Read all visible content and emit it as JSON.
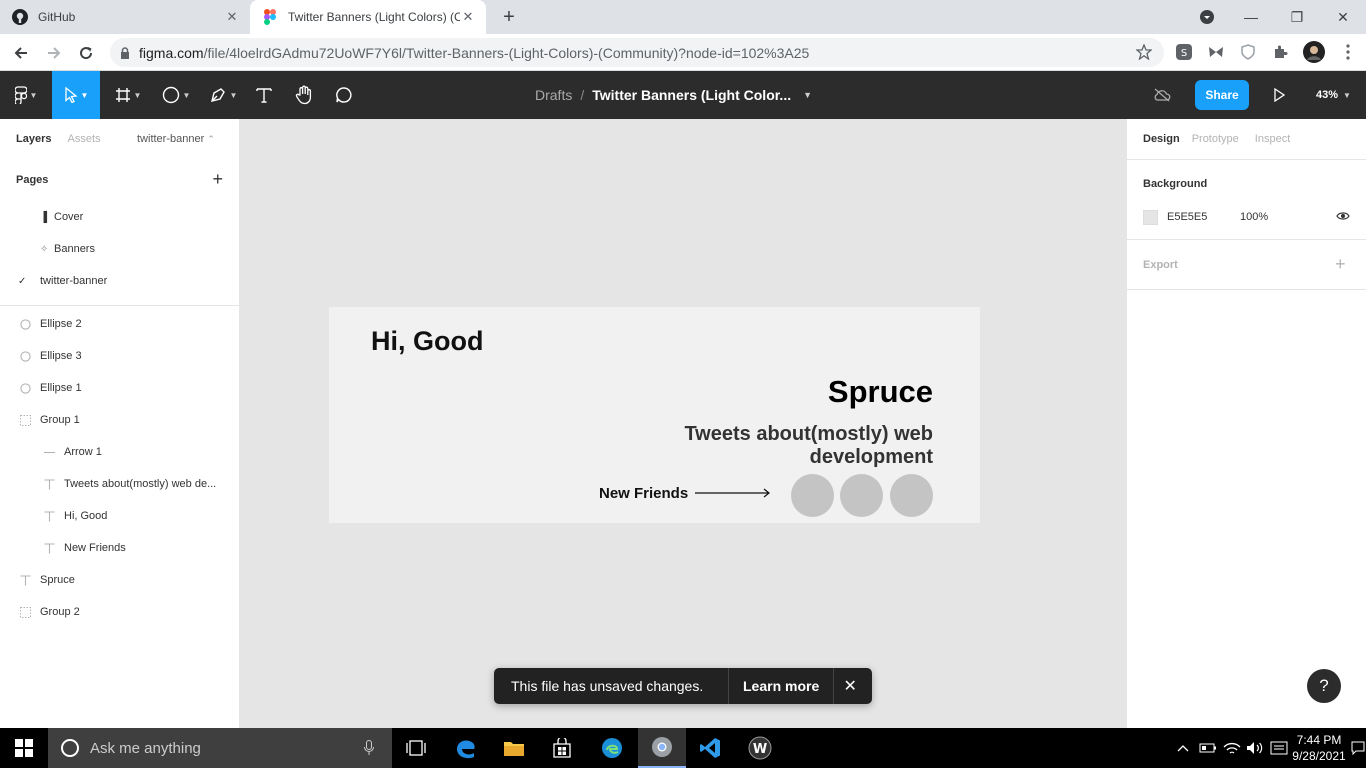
{
  "browser": {
    "tabs": [
      {
        "title": "GitHub",
        "icon": "github-icon"
      },
      {
        "title": "Twitter Banners (Light Colors) (Co",
        "icon": "figma-icon"
      }
    ],
    "url_host": "figma.com",
    "url_path": "/file/4loelrdGAdmu72UoWF7Y6l/Twitter-Banners-(Light-Colors)-(Community)?node-id=102%3A25"
  },
  "figma_toolbar": {
    "breadcrumb_drafts": "Drafts",
    "breadcrumb_sep": "/",
    "file_name": "Twitter Banners (Light Color...",
    "share_label": "Share",
    "zoom": "43%",
    "tools": [
      "main-menu",
      "move",
      "frame",
      "ellipse",
      "pen",
      "text",
      "hand",
      "comment"
    ]
  },
  "left_panel": {
    "tab_layers": "Layers",
    "tab_assets": "Assets",
    "current_page": "twitter-banner",
    "pages_heading": "Pages",
    "pages": [
      {
        "label": "Cover",
        "icon": "▐"
      },
      {
        "label": "Banners",
        "icon": "✧"
      },
      {
        "label": "twitter-banner",
        "icon": "✓"
      }
    ],
    "layers": [
      {
        "label": "Ellipse 2",
        "icon": "ellipse-icon",
        "indent": 0
      },
      {
        "label": "Ellipse 3",
        "icon": "ellipse-icon",
        "indent": 0
      },
      {
        "label": "Ellipse 1",
        "icon": "ellipse-icon",
        "indent": 0
      },
      {
        "label": "Group 1",
        "icon": "group-icon",
        "indent": 0
      },
      {
        "label": "Arrow 1",
        "icon": "line-icon",
        "indent": 1
      },
      {
        "label": "Tweets about(mostly) web de...",
        "icon": "text-icon",
        "indent": 1
      },
      {
        "label": "Hi, Good",
        "icon": "text-icon",
        "indent": 1
      },
      {
        "label": "New Friends",
        "icon": "text-icon",
        "indent": 1
      },
      {
        "label": "Spruce",
        "icon": "text-icon",
        "indent": 0
      },
      {
        "label": "Group 2",
        "icon": "group-icon",
        "indent": 0
      }
    ]
  },
  "banner": {
    "greeting": "Hi, Good",
    "name": "Spruce",
    "tagline": "Tweets about(mostly) web development",
    "cta": "New Friends",
    "circle_color": "#c4c4c4"
  },
  "toast": {
    "message": "This file has unsaved changes.",
    "action": "Learn more"
  },
  "right_panel": {
    "tab_design": "Design",
    "tab_prototype": "Prototype",
    "tab_inspect": "Inspect",
    "background_title": "Background",
    "background_hex": "E5E5E5",
    "background_opacity": "100%",
    "export_title": "Export",
    "help": "?"
  },
  "taskbar": {
    "search_placeholder": "Ask me anything",
    "time": "7:44 PM",
    "date": "9/28/2021"
  },
  "colors": {
    "accent": "#18a0fb",
    "toolbar_bg": "#2c2c2c",
    "canvas_bg": "#e5e5e5"
  }
}
